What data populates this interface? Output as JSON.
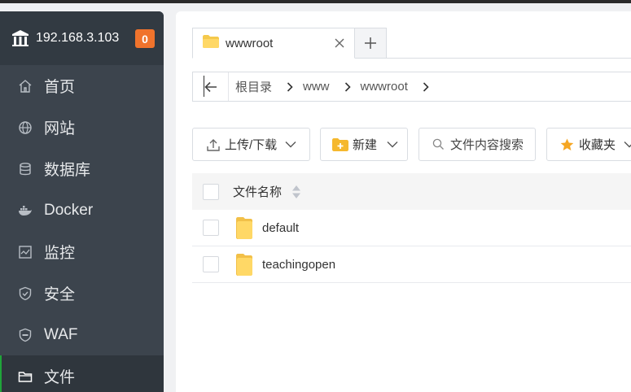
{
  "sidebar": {
    "server_ip": "192.168.3.103",
    "notification_count": "0",
    "items": [
      {
        "label": "首页",
        "icon": "home-icon"
      },
      {
        "label": "网站",
        "icon": "globe-icon"
      },
      {
        "label": "数据库",
        "icon": "database-icon"
      },
      {
        "label": "Docker",
        "icon": "docker-icon"
      },
      {
        "label": "监控",
        "icon": "monitor-icon"
      },
      {
        "label": "安全",
        "icon": "shield-icon"
      },
      {
        "label": "WAF",
        "icon": "waf-shield-icon"
      },
      {
        "label": "文件",
        "icon": "folder-icon",
        "active": true
      }
    ]
  },
  "tabs": {
    "active_label": "wwwroot",
    "add_symbol": "+"
  },
  "path": {
    "crumbs": [
      "根目录",
      "www",
      "wwwroot"
    ]
  },
  "toolbar": {
    "upload_label": "上传/下载",
    "new_label": "新建",
    "search_label": "文件内容搜索",
    "favorites_label": "收藏夹"
  },
  "table": {
    "header_name": "文件名称",
    "rows": [
      {
        "name": "default",
        "type": "folder"
      },
      {
        "name": "teachingopen",
        "type": "folder"
      }
    ]
  },
  "colors": {
    "sidebar_bg": "#3c444d",
    "active_accent": "#20a53a",
    "badge": "#f0732c",
    "folder": "#f5c94c"
  }
}
